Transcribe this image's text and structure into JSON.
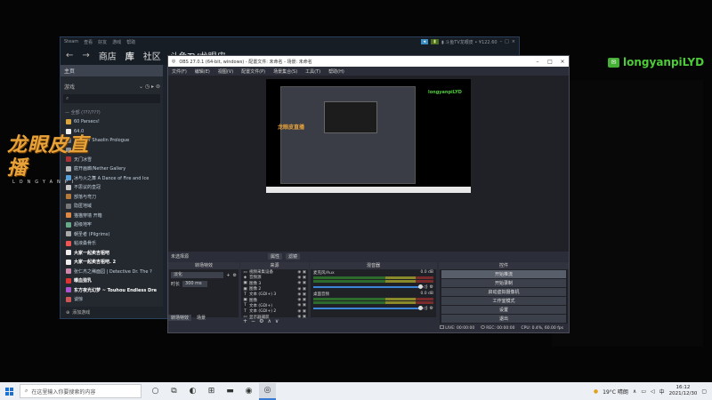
{
  "steam": {
    "titlebar_menu": [
      "Steam",
      "查看",
      "好友",
      "游戏",
      "帮助"
    ],
    "nav": {
      "store": "商店",
      "library": "库",
      "community": "社区",
      "user": "斗鱼TV龙眼皮"
    },
    "account_status": "▮ 斗鱼TV龙眼皮 • ¥122.60",
    "home": "主页",
    "filter_label": "游戏",
    "category": "— 全部 (???/???)",
    "games": [
      {
        "name": "60 Parsecs!",
        "color": "#d9a43b",
        "bold": false
      },
      {
        "name": "64.0",
        "color": "#f0f0f0",
        "bold": false
      },
      {
        "name": "Tales of Shaolin Prologue",
        "color": "#6f7b85",
        "bold": false
      },
      {
        "name": "",
        "color": "#8a8f95",
        "bold": false
      },
      {
        "name": "天门冰雪",
        "color": "#a33",
        "bold": false
      },
      {
        "name": "庭开画廊/Nether Gallery",
        "color": "#b8b8b8",
        "bold": false
      },
      {
        "name": "冰与火之舞 A Dance of Fire and Ice",
        "color": "#5aa0d8",
        "bold": false
      },
      {
        "name": "不思议的皇冠",
        "color": "#c8c8c8",
        "bold": false
      },
      {
        "name": "部落与弯刀",
        "color": "#b37a3a",
        "bold": false
      },
      {
        "name": "隐匿地域",
        "color": "#777",
        "bold": false
      },
      {
        "name": "猫猫穿墙  开箱",
        "color": "#d84",
        "bold": false
      },
      {
        "name": "超级地牢",
        "color": "#6a8",
        "bold": false
      },
      {
        "name": "朝圣者 (Pilgrims)",
        "color": "#aaa",
        "bold": false
      },
      {
        "name": "粘液桑骨乐",
        "color": "#e55",
        "bold": false
      },
      {
        "name": "大家一起卖吉祖吧",
        "color": "#eee",
        "bold": true
      },
      {
        "name": "大家一起卖吉祖吧. 2",
        "color": "#eee",
        "bold": true
      },
      {
        "name": "张仁杰之稀面园 | Detective Dr. The ?",
        "color": "#c8a",
        "bold": false
      },
      {
        "name": "曝血猎乳",
        "color": "#d33",
        "bold": true
      },
      {
        "name": "东方夜光幻梦 ~ Touhou Endless Dre",
        "color": "#a5c",
        "bold": true
      },
      {
        "name": "谈惊",
        "color": "#c55",
        "bold": false
      }
    ],
    "add_game": "添加游戏"
  },
  "logo": {
    "main": "龙眼皮直播",
    "sub": "LONGYANPI"
  },
  "wechat": {
    "handle": "longyanpiLYD"
  },
  "obs": {
    "title": "OBS 27.0.1 (64-bit, windows) - 配置文件: 未命名 - 场景: 未命名",
    "menu": [
      "文件(F)",
      "编辑(E)",
      "视图(V)",
      "配置文件(P)",
      "场景集合(S)",
      "工具(T)",
      "帮助(H)"
    ],
    "scene_label": "未选择源",
    "scene_buttons": [
      "属性",
      "滤镜"
    ],
    "docks": {
      "transitions": "转场特效",
      "sources": "来源",
      "mixer": "混音器",
      "controls": "控件"
    },
    "transition": {
      "type": "淡化",
      "duration_label": "时长",
      "duration": "300 ms"
    },
    "sources": [
      {
        "icon": "▭",
        "name": "视频采集设备"
      },
      {
        "icon": "◈",
        "name": "音频源"
      },
      {
        "icon": "▣",
        "name": "图像 3"
      },
      {
        "icon": "▣",
        "name": "图像 2"
      },
      {
        "icon": "T",
        "name": "文本 (GDI+) 3"
      },
      {
        "icon": "▣",
        "name": "图像"
      },
      {
        "icon": "T",
        "name": "文本 (GDI+)"
      },
      {
        "icon": "T",
        "name": "文本 (GDI+) 2"
      },
      {
        "icon": "▭",
        "name": "显示器捕获"
      }
    ],
    "mixer_tracks": [
      {
        "name": "麦克风/Aux",
        "db": "0.0 dB"
      },
      {
        "name": "桌面音频",
        "db": "0.0 dB"
      }
    ],
    "controls": [
      "开始推流",
      "开始录制",
      "启动虚拟摄像机",
      "工作室模式",
      "设置",
      "退出"
    ],
    "bottom_tabs": [
      "转场特效",
      "场景"
    ],
    "status": {
      "live": "LIVE: 00:00:00",
      "rec": "REC: 00:00:00",
      "cpu": "CPU: 0.4%, 60.00 fps"
    }
  },
  "taskbar": {
    "search_placeholder": "在这里输入你要搜索的内容",
    "icons": [
      {
        "name": "cortana-icon",
        "glyph": "○",
        "active": false
      },
      {
        "name": "task-view-icon",
        "glyph": "⧉",
        "active": false
      },
      {
        "name": "edge-icon",
        "glyph": "◐",
        "active": false
      },
      {
        "name": "store-icon",
        "glyph": "⊞",
        "active": false
      },
      {
        "name": "explorer-icon",
        "glyph": "▬",
        "active": false
      },
      {
        "name": "steam-icon",
        "glyph": "◉",
        "active": false
      },
      {
        "name": "obs-icon",
        "glyph": "◎",
        "active": true
      }
    ],
    "weather": "19°C 晴朗",
    "ime": "中",
    "time": "16:12",
    "date": "2021/12/30"
  }
}
